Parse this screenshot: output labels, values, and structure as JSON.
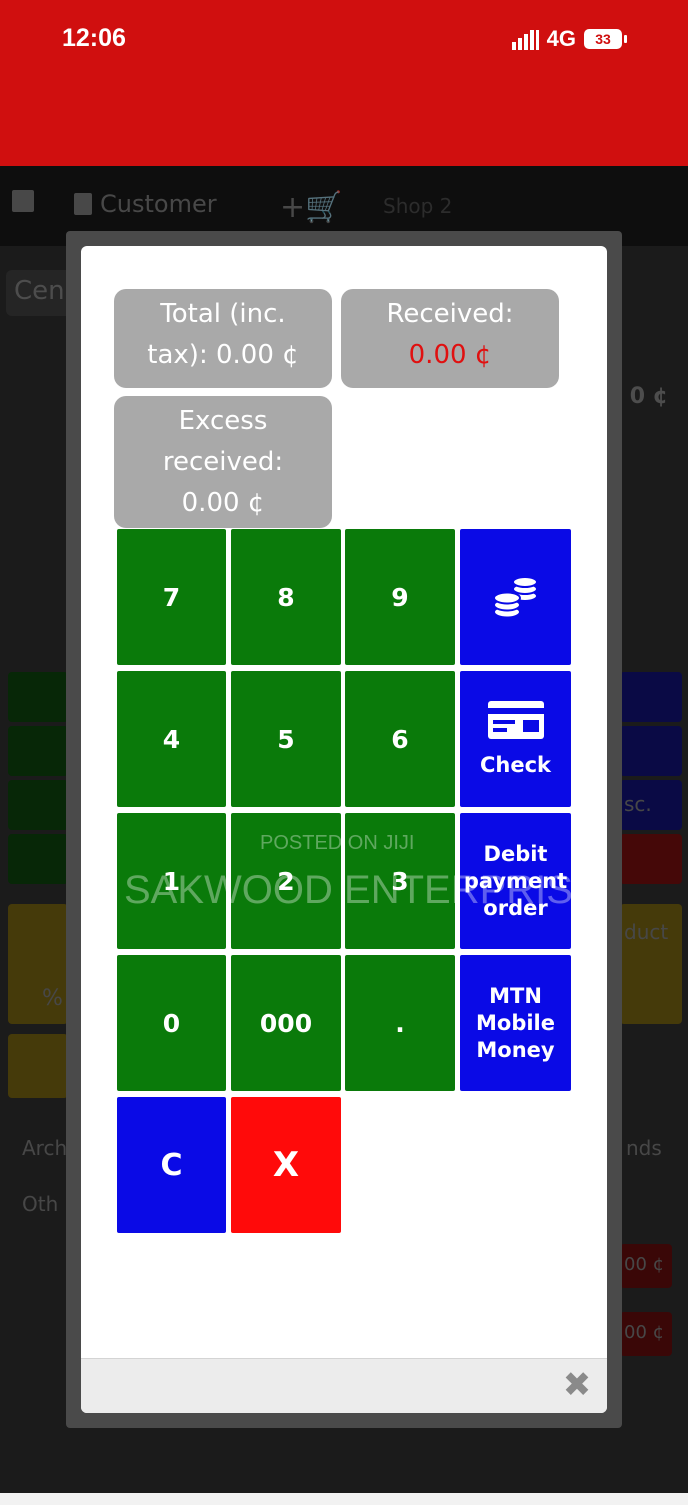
{
  "status_bar": {
    "time": "12:06",
    "network": "4G",
    "battery": "33",
    "color": "#d00f0f"
  },
  "background_app": {
    "toolbar": {
      "customer_label": "Customer",
      "shop_label": "Shop 2"
    },
    "search_partial": "Cen",
    "total_partial": "0 ¢",
    "row_labels": [
      "Arch",
      "Oth"
    ],
    "row_right_labels": [
      "nds"
    ],
    "price_badges": [
      "00 ¢",
      "00 ¢"
    ],
    "side_labels": [
      "sc.",
      "duct"
    ],
    "percent_symbol": "%"
  },
  "payment_dialog": {
    "total_label_line1": "Total (inc.",
    "total_label_line2": "tax): 0.00 ¢",
    "received_label": "Received:",
    "received_value": "0.00 ¢",
    "excess_label_line1": "Excess",
    "excess_label_line2": "received:",
    "excess_value": "0.00 ¢",
    "keys": {
      "k7": "7",
      "k8": "8",
      "k9": "9",
      "k4": "4",
      "k5": "5",
      "k6": "6",
      "k1": "1",
      "k2": "2",
      "k3": "3",
      "k0": "0",
      "k000": "000",
      "kdot": ".",
      "clear": "C",
      "cancel": "X"
    },
    "methods": {
      "check": "Check",
      "debit_line1": "Debit",
      "debit_line2": "payment",
      "debit_line3": "order",
      "mtn_line1": "MTN",
      "mtn_line2": "Mobile",
      "mtn_line3": "Money"
    },
    "close_icon": "close-icon",
    "colors": {
      "digit_key": "#0a7a0a",
      "method_key": "#0a0ae6",
      "cancel_key": "#ff0a0a",
      "info_box": "#a9a9a9",
      "received_value": "#e01010"
    }
  },
  "watermark": {
    "line1": "POSTED ON JIJI",
    "line2": "SAKWOOD ENTERPRISE"
  }
}
